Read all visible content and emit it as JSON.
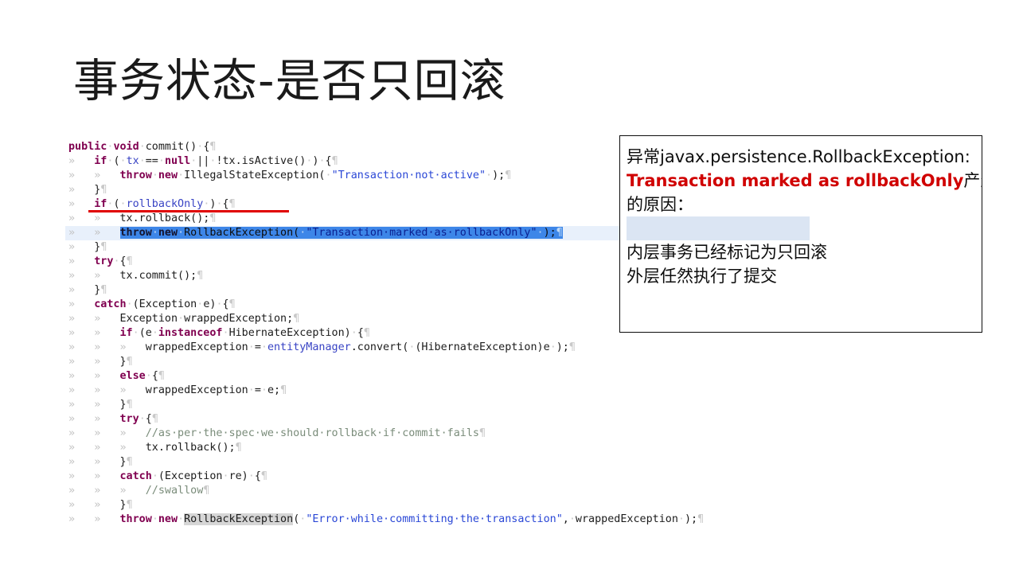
{
  "slide": {
    "title": "事务状态-是否只回滚",
    "background_color": "#ffffff"
  },
  "code": {
    "language": "java",
    "font": "monospace",
    "colors": {
      "keyword": "#800050",
      "string": "#2a47d6",
      "field": "#3843c4",
      "comment": "#7a8c7a",
      "plain": "#1c1c1c",
      "selection_background": "#3d86e8",
      "current_line_background": "#e8f0fb",
      "identifier_highlight": "#d6d6d6",
      "tab_guide": "#c2c2c2",
      "pilcrow": "#c9c9c9"
    },
    "lines": [
      {
        "indent": 0,
        "text": "public void commit() {",
        "tokens": [
          {
            "t": "public",
            "c": "kw"
          },
          {
            "t": "·",
            "c": "dot"
          },
          {
            "t": "void",
            "c": "kw"
          },
          {
            "t": "·",
            "c": "dot"
          },
          {
            "t": "commit()",
            "c": "plain"
          },
          {
            "t": "·",
            "c": "dot"
          },
          {
            "t": "{",
            "c": "plain"
          },
          {
            "t": "¶",
            "c": "pilcrow"
          }
        ]
      },
      {
        "indent": 1,
        "text": "if ( tx == null || !tx.isActive() ) {",
        "tokens": [
          {
            "t": "if",
            "c": "kw"
          },
          {
            "t": "·",
            "c": "dot"
          },
          {
            "t": "(",
            "c": "plain"
          },
          {
            "t": "·",
            "c": "dot"
          },
          {
            "t": "tx",
            "c": "field"
          },
          {
            "t": "·",
            "c": "dot"
          },
          {
            "t": "==",
            "c": "plain"
          },
          {
            "t": "·",
            "c": "dot"
          },
          {
            "t": "null",
            "c": "kw"
          },
          {
            "t": "·",
            "c": "dot"
          },
          {
            "t": "||",
            "c": "plain"
          },
          {
            "t": "·",
            "c": "dot"
          },
          {
            "t": "!tx.isActive()",
            "c": "plain"
          },
          {
            "t": "·",
            "c": "dot"
          },
          {
            "t": ")",
            "c": "plain"
          },
          {
            "t": "·",
            "c": "dot"
          },
          {
            "t": "{",
            "c": "plain"
          },
          {
            "t": "¶",
            "c": "pilcrow"
          }
        ]
      },
      {
        "indent": 2,
        "text": "throw new IllegalStateException( \"Transaction not active\" );",
        "tokens": [
          {
            "t": "throw",
            "c": "kw"
          },
          {
            "t": "·",
            "c": "dot"
          },
          {
            "t": "new",
            "c": "kw"
          },
          {
            "t": "·",
            "c": "dot"
          },
          {
            "t": "IllegalStateException(",
            "c": "plain"
          },
          {
            "t": "·",
            "c": "dot"
          },
          {
            "t": "\"Transaction·not·active\"",
            "c": "str"
          },
          {
            "t": "·",
            "c": "dot"
          },
          {
            "t": ");",
            "c": "plain"
          },
          {
            "t": "¶",
            "c": "pilcrow"
          }
        ]
      },
      {
        "indent": 1,
        "text": "}",
        "tokens": [
          {
            "t": "}",
            "c": "plain"
          },
          {
            "t": "¶",
            "c": "pilcrow"
          }
        ]
      },
      {
        "indent": 1,
        "text": "if ( rollbackOnly ) {",
        "underlined_red": true,
        "tokens": [
          {
            "t": "if",
            "c": "kw"
          },
          {
            "t": "·",
            "c": "dot"
          },
          {
            "t": "(",
            "c": "plain"
          },
          {
            "t": "·",
            "c": "dot"
          },
          {
            "t": "rollbackOnly",
            "c": "field"
          },
          {
            "t": "·",
            "c": "dot"
          },
          {
            "t": ")",
            "c": "plain"
          },
          {
            "t": "·",
            "c": "dot"
          },
          {
            "t": "{",
            "c": "plain"
          },
          {
            "t": "¶",
            "c": "pilcrow"
          }
        ]
      },
      {
        "indent": 2,
        "text": "tx.rollback();",
        "tokens": [
          {
            "t": "tx.rollback();",
            "c": "plain"
          },
          {
            "t": "¶",
            "c": "pilcrow"
          }
        ]
      },
      {
        "indent": 2,
        "selected": true,
        "current": true,
        "text": "throw new RollbackException( \"Transaction marked as rollbackOnly\" );",
        "tokens": [
          {
            "t": "throw",
            "c": "kw"
          },
          {
            "t": "·",
            "c": "dot"
          },
          {
            "t": "new",
            "c": "kw"
          },
          {
            "t": "·",
            "c": "dot"
          },
          {
            "t": "RollbackException(",
            "c": "plain"
          },
          {
            "t": "·",
            "c": "dot"
          },
          {
            "t": "\"Transaction·marked·as·rollbackOnly\"",
            "c": "str"
          },
          {
            "t": "·",
            "c": "dot"
          },
          {
            "t": ");",
            "c": "plain"
          },
          {
            "t": "¶",
            "c": "pilcrow"
          }
        ]
      },
      {
        "indent": 1,
        "text": "}",
        "tokens": [
          {
            "t": "}",
            "c": "plain"
          },
          {
            "t": "¶",
            "c": "pilcrow"
          }
        ]
      },
      {
        "indent": 1,
        "text": "try {",
        "tokens": [
          {
            "t": "try",
            "c": "kw"
          },
          {
            "t": "·",
            "c": "dot"
          },
          {
            "t": "{",
            "c": "plain"
          },
          {
            "t": "¶",
            "c": "pilcrow"
          }
        ]
      },
      {
        "indent": 2,
        "text": "tx.commit();",
        "tokens": [
          {
            "t": "tx.commit();",
            "c": "plain"
          },
          {
            "t": "¶",
            "c": "pilcrow"
          }
        ]
      },
      {
        "indent": 1,
        "text": "}",
        "tokens": [
          {
            "t": "}",
            "c": "plain"
          },
          {
            "t": "¶",
            "c": "pilcrow"
          }
        ]
      },
      {
        "indent": 1,
        "text": "catch (Exception e) {",
        "tokens": [
          {
            "t": "catch",
            "c": "kw"
          },
          {
            "t": "·",
            "c": "dot"
          },
          {
            "t": "(Exception",
            "c": "plain"
          },
          {
            "t": "·",
            "c": "dot"
          },
          {
            "t": "e)",
            "c": "plain"
          },
          {
            "t": "·",
            "c": "dot"
          },
          {
            "t": "{",
            "c": "plain"
          },
          {
            "t": "¶",
            "c": "pilcrow"
          }
        ]
      },
      {
        "indent": 2,
        "text": "Exception wrappedException;",
        "tokens": [
          {
            "t": "Exception",
            "c": "plain"
          },
          {
            "t": "·",
            "c": "dot"
          },
          {
            "t": "wrappedException;",
            "c": "plain"
          },
          {
            "t": "¶",
            "c": "pilcrow"
          }
        ]
      },
      {
        "indent": 2,
        "text": "if (e instanceof HibernateException) {",
        "tokens": [
          {
            "t": "if",
            "c": "kw"
          },
          {
            "t": "·",
            "c": "dot"
          },
          {
            "t": "(e",
            "c": "plain"
          },
          {
            "t": "·",
            "c": "dot"
          },
          {
            "t": "instanceof",
            "c": "kw"
          },
          {
            "t": "·",
            "c": "dot"
          },
          {
            "t": "HibernateException)",
            "c": "plain"
          },
          {
            "t": "·",
            "c": "dot"
          },
          {
            "t": "{",
            "c": "plain"
          },
          {
            "t": "¶",
            "c": "pilcrow"
          }
        ]
      },
      {
        "indent": 3,
        "text": "wrappedException = entityManager.convert( (HibernateException)e );",
        "tokens": [
          {
            "t": "wrappedException",
            "c": "plain"
          },
          {
            "t": "·",
            "c": "dot"
          },
          {
            "t": "=",
            "c": "plain"
          },
          {
            "t": "·",
            "c": "dot"
          },
          {
            "t": "entityManager",
            "c": "field"
          },
          {
            "t": ".convert(",
            "c": "plain"
          },
          {
            "t": "·",
            "c": "dot"
          },
          {
            "t": "(HibernateException)e",
            "c": "plain"
          },
          {
            "t": "·",
            "c": "dot"
          },
          {
            "t": ");",
            "c": "plain"
          },
          {
            "t": "¶",
            "c": "pilcrow"
          }
        ]
      },
      {
        "indent": 2,
        "text": "}",
        "tokens": [
          {
            "t": "}",
            "c": "plain"
          },
          {
            "t": "¶",
            "c": "pilcrow"
          }
        ]
      },
      {
        "indent": 2,
        "text": "else {",
        "tokens": [
          {
            "t": "else",
            "c": "kw"
          },
          {
            "t": "·",
            "c": "dot"
          },
          {
            "t": "{",
            "c": "plain"
          },
          {
            "t": "¶",
            "c": "pilcrow"
          }
        ]
      },
      {
        "indent": 3,
        "text": "wrappedException = e;",
        "tokens": [
          {
            "t": "wrappedException",
            "c": "plain"
          },
          {
            "t": "·",
            "c": "dot"
          },
          {
            "t": "=",
            "c": "plain"
          },
          {
            "t": "·",
            "c": "dot"
          },
          {
            "t": "e;",
            "c": "plain"
          },
          {
            "t": "¶",
            "c": "pilcrow"
          }
        ]
      },
      {
        "indent": 2,
        "text": "}",
        "tokens": [
          {
            "t": "}",
            "c": "plain"
          },
          {
            "t": "¶",
            "c": "pilcrow"
          }
        ]
      },
      {
        "indent": 2,
        "text": "try {",
        "tokens": [
          {
            "t": "try",
            "c": "kw"
          },
          {
            "t": "·",
            "c": "dot"
          },
          {
            "t": "{",
            "c": "plain"
          },
          {
            "t": "¶",
            "c": "pilcrow"
          }
        ]
      },
      {
        "indent": 3,
        "text": "//as per the spec we should rollback if commit fails",
        "tokens": [
          {
            "t": "//as·per·the·spec·we·should·rollback·if·commit·fails",
            "c": "cmt"
          },
          {
            "t": "¶",
            "c": "pilcrow"
          }
        ]
      },
      {
        "indent": 3,
        "text": "tx.rollback();",
        "tokens": [
          {
            "t": "tx.rollback();",
            "c": "plain"
          },
          {
            "t": "¶",
            "c": "pilcrow"
          }
        ]
      },
      {
        "indent": 2,
        "text": "}",
        "tokens": [
          {
            "t": "}",
            "c": "plain"
          },
          {
            "t": "¶",
            "c": "pilcrow"
          }
        ]
      },
      {
        "indent": 2,
        "text": "catch (Exception re) {",
        "tokens": [
          {
            "t": "catch",
            "c": "kw"
          },
          {
            "t": "·",
            "c": "dot"
          },
          {
            "t": "(Exception",
            "c": "plain"
          },
          {
            "t": "·",
            "c": "dot"
          },
          {
            "t": "re)",
            "c": "plain"
          },
          {
            "t": "·",
            "c": "dot"
          },
          {
            "t": "{",
            "c": "plain"
          },
          {
            "t": "¶",
            "c": "pilcrow"
          }
        ]
      },
      {
        "indent": 3,
        "text": "//swallow",
        "tokens": [
          {
            "t": "//swallow",
            "c": "cmt"
          },
          {
            "t": "¶",
            "c": "pilcrow"
          }
        ]
      },
      {
        "indent": 2,
        "text": "}",
        "tokens": [
          {
            "t": "}",
            "c": "plain"
          },
          {
            "t": "¶",
            "c": "pilcrow"
          }
        ]
      },
      {
        "indent": 2,
        "text": "throw new RollbackException( \"Error while committing the transaction\", wrappedException );",
        "tokens": [
          {
            "t": "throw",
            "c": "kw"
          },
          {
            "t": "·",
            "c": "dot"
          },
          {
            "t": "new",
            "c": "kw"
          },
          {
            "t": "·",
            "c": "dot"
          },
          {
            "t": "RollbackException",
            "c": "plain idhl"
          },
          {
            "t": "(",
            "c": "plain"
          },
          {
            "t": "·",
            "c": "dot"
          },
          {
            "t": "\"Error·while·committing·the·transaction\"",
            "c": "str"
          },
          {
            "t": ",",
            "c": "plain"
          },
          {
            "t": "·",
            "c": "dot"
          },
          {
            "t": "wrappedException",
            "c": "plain"
          },
          {
            "t": "·",
            "c": "dot"
          },
          {
            "t": ");",
            "c": "plain"
          },
          {
            "t": "¶",
            "c": "pilcrow"
          }
        ]
      }
    ]
  },
  "note_box": {
    "border_color": "#0d0d0d",
    "highlight_band_color": "#dbe5f3",
    "accent_color": "#d00000",
    "lines": [
      {
        "type": "text",
        "segments": [
          {
            "t": "异常javax.persistence.RollbackException:",
            "style": "normal"
          }
        ]
      },
      {
        "type": "text",
        "segments": [
          {
            "t": "Transaction marked as rollbackOnly",
            "style": "red-bold"
          },
          {
            "t": "产生",
            "style": "normal"
          }
        ]
      },
      {
        "type": "text",
        "segments": [
          {
            "t": "的原因：",
            "style": "normal"
          }
        ]
      },
      {
        "type": "blank-band"
      },
      {
        "type": "text",
        "segments": [
          {
            "t": "内层事务已经标记为只回滚",
            "style": "normal"
          }
        ]
      },
      {
        "type": "text",
        "segments": [
          {
            "t": "外层任然执行了提交",
            "style": "normal"
          }
        ]
      }
    ]
  }
}
